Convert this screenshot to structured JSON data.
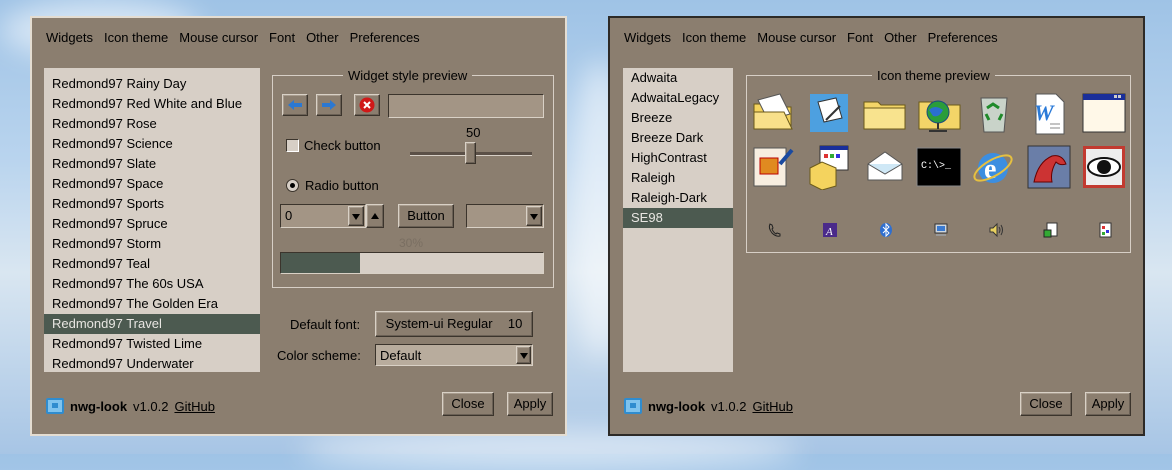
{
  "left": {
    "menu": [
      "Widgets",
      "Icon theme",
      "Mouse cursor",
      "Font",
      "Other",
      "Preferences"
    ],
    "themes": [
      "Redmond97 Rainy Day",
      "Redmond97 Red White and Blue",
      "Redmond97 Rose",
      "Redmond97 Science",
      "Redmond97 Slate",
      "Redmond97 Space",
      "Redmond97 Sports",
      "Redmond97 Spruce",
      "Redmond97 Storm",
      "Redmond97 Teal",
      "Redmond97 The 60s USA",
      "Redmond97 The Golden Era",
      "Redmond97 Travel",
      "Redmond97 Twisted Lime",
      "Redmond97 Underwater"
    ],
    "selected_index": 12,
    "preview": {
      "legend": "Widget style preview",
      "check_label": "Check button",
      "radio_label": "Radio button",
      "slider_value": "50",
      "slider_fraction": 0.5,
      "spin_value": "0",
      "button_label": "Button",
      "progress_text": "30%",
      "progress_fraction": 0.3
    },
    "default_font_label": "Default font:",
    "font_name": "System-ui Regular",
    "font_size": "10",
    "color_scheme_label": "Color scheme:",
    "color_scheme_value": "Default",
    "footer": {
      "app": "nwg-look",
      "version": "v1.0.2",
      "link": "GitHub"
    },
    "close_label": "Close",
    "apply_label": "Apply"
  },
  "right": {
    "menu": [
      "Widgets",
      "Icon theme",
      "Mouse cursor",
      "Font",
      "Other",
      "Preferences"
    ],
    "icon_themes": [
      "Adwaita",
      "AdwaitaLegacy",
      "Breeze",
      "Breeze Dark",
      "HighContrast",
      "Raleigh",
      "Raleigh-Dark",
      "SE98"
    ],
    "selected_index": 7,
    "preview_legend": "Icon theme preview",
    "terminal_text": "C:\\>_",
    "large_icons": [
      "folder-open-icon",
      "document-edit-icon",
      "folder-icon",
      "network-folder-icon",
      "recycle-bin-icon",
      "word-document-icon",
      "window-icon",
      "image-editor-icon",
      "package-installer-icon",
      "mail-icon",
      "terminal-icon",
      "browser-icon",
      "game-dragon-icon",
      "eye-icon"
    ],
    "small_icons": [
      "phone-icon",
      "font-icon",
      "bluetooth-icon",
      "computer-icon",
      "speaker-icon",
      "document-icon",
      "settings-icon"
    ],
    "footer": {
      "app": "nwg-look",
      "version": "v1.0.2",
      "link": "GitHub"
    },
    "close_label": "Close",
    "apply_label": "Apply"
  },
  "colors": {
    "window_bg": "#8b7e6f",
    "list_bg": "#d7cfc6",
    "selection": "#4c5a50"
  }
}
